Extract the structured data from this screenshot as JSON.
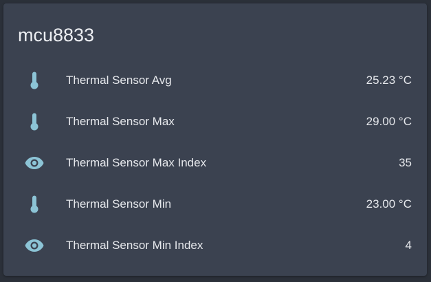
{
  "card": {
    "title": "mcu8833",
    "icon_color": "#8cc4d6",
    "rows": [
      {
        "icon": "thermometer-icon",
        "name": "Thermal Sensor Avg",
        "value": "25.23 °C"
      },
      {
        "icon": "thermometer-icon",
        "name": "Thermal Sensor Max",
        "value": "29.00 °C"
      },
      {
        "icon": "eye-icon",
        "name": "Thermal Sensor Max Index",
        "value": "35"
      },
      {
        "icon": "thermometer-icon",
        "name": "Thermal Sensor Min",
        "value": "23.00 °C"
      },
      {
        "icon": "eye-icon",
        "name": "Thermal Sensor Min Index",
        "value": "4"
      }
    ]
  }
}
